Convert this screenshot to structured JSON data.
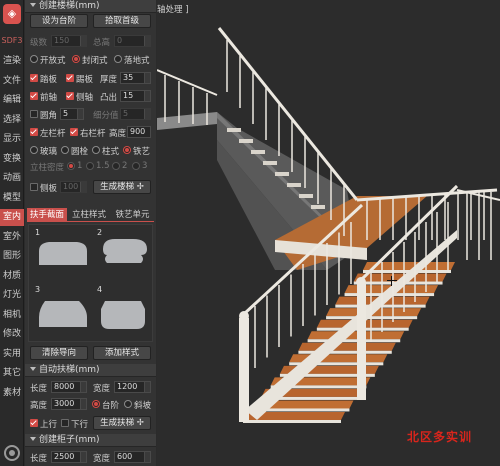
{
  "app": {
    "version": "SDF3",
    "viewport_title": "轴处理 ]",
    "watermark": "北区多实训"
  },
  "rail": {
    "tabs": [
      "渲染",
      "文件",
      "编辑",
      "选择",
      "显示",
      "变换",
      "动画",
      "模型",
      "室内",
      "室外",
      "图形",
      "材质",
      "灯光",
      "相机",
      "修改",
      "实用",
      "其它",
      "素材"
    ],
    "active": "室内"
  },
  "stair_section": {
    "title": "创建楼梯(mm)",
    "btn_set_step": "设为台阶",
    "btn_pick_step": "拾取首级",
    "step_count_label": "级数",
    "step_count_value": "150",
    "total_height_label": "总高",
    "total_height_value": "0",
    "types": [
      "开放式",
      "封闭式",
      "落地式"
    ],
    "type_selected": "封闭式",
    "tread_label": "踏板",
    "riser_label": "踢板",
    "thickness_label": "厚度",
    "thickness_value": "35",
    "front_label": "前轴",
    "side_label": "侧轴",
    "protrude_label": "凸出",
    "protrude_value": "15",
    "round_label": "圆角",
    "round_value": "5",
    "segments_label": "细分值",
    "segments_value": "5",
    "left_rail_label": "左栏杆",
    "right_rail_label": "右栏杆",
    "rail_height_label": "高度",
    "rail_height_value": "900",
    "rail_types": [
      "玻璃",
      "圆栓",
      "柱式",
      "铁艺"
    ],
    "rail_type_selected": "铁艺",
    "post_density_label": "立柱密度",
    "post_densities": [
      "1",
      "1.5",
      "2",
      "3"
    ],
    "side_plate_label": "侧板",
    "side_plate_value": "100",
    "create_btn": "生成楼梯"
  },
  "profile_tabs": {
    "items": [
      "扶手截面",
      "立柱样式",
      "铁艺单元"
    ],
    "active": "扶手截面"
  },
  "profiles": {
    "numbers": [
      "1",
      "2",
      "3",
      "4"
    ],
    "clear_btn": "清除导向",
    "add_btn": "添加样式"
  },
  "handrail_section": {
    "title": "自动扶梯(mm)",
    "length_label": "长度",
    "length_value": "8000",
    "width_label": "宽度",
    "width_value": "1200",
    "height_label": "高度",
    "height_value": "3000",
    "modes": [
      "台阶",
      "斜坡"
    ],
    "mode_selected": "台阶",
    "up_label": "上行",
    "down_label": "下行",
    "create_btn": "生成扶梯"
  },
  "cabinet_section": {
    "title": "创建柜子(mm)",
    "length_label": "长度",
    "length_value": "2500",
    "width_label": "宽度",
    "width_value": "600"
  },
  "colors": {
    "accent": "#d24a45",
    "panel": "#333333",
    "viewport": "#2c2c2c",
    "tread": "#b8652e",
    "rail": "#e8e4dc"
  }
}
